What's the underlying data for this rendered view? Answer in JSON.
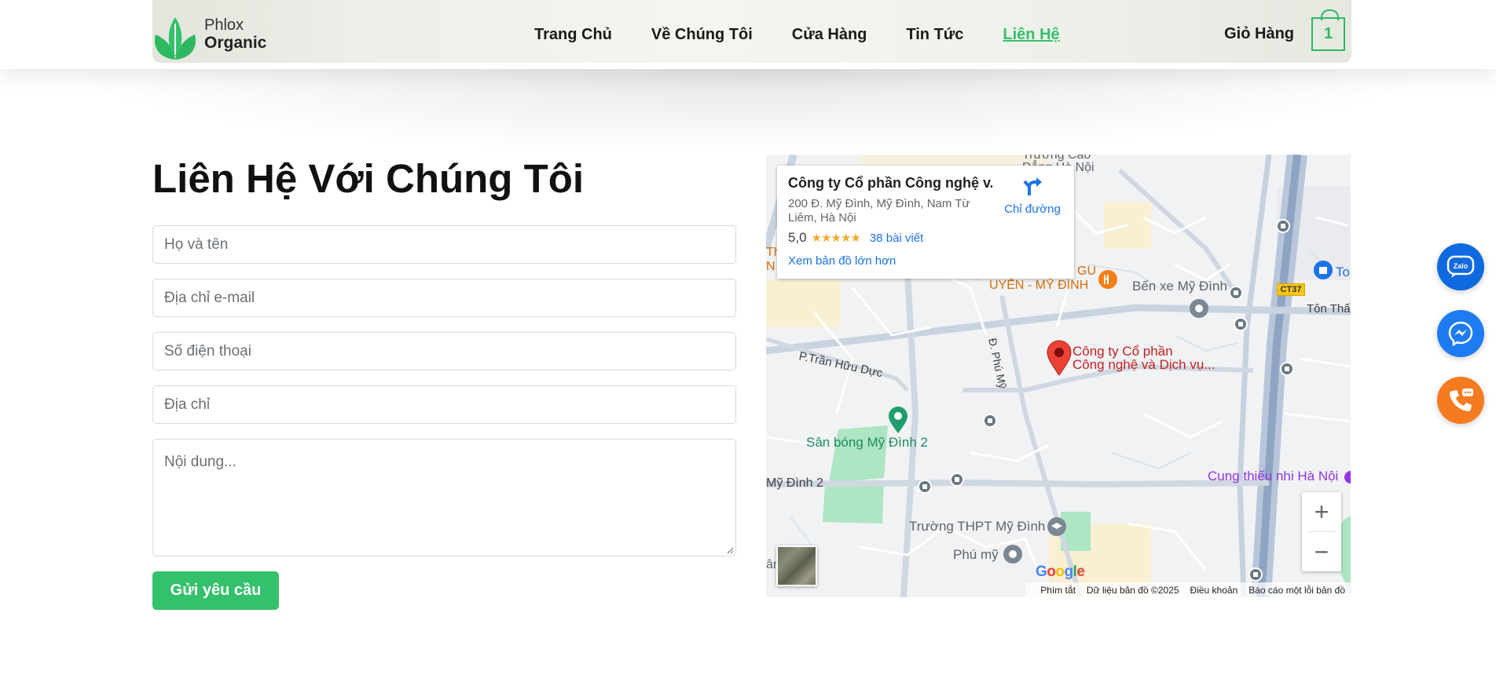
{
  "header": {
    "logo_top": "Phlox",
    "logo_bottom": "Organic",
    "nav": [
      "Trang Chủ",
      "Về Chúng Tôi",
      "Cửa Hàng",
      "Tin Tức",
      "Liên Hệ"
    ],
    "active_nav": "Liên Hệ",
    "cart_label": "Giỏ Hàng",
    "cart_count": "1"
  },
  "contact": {
    "title": "Liên Hệ Với Chúng Tôi",
    "name_placeholder": "Họ và tên",
    "email_placeholder": "Địa chỉ e-mail",
    "phone_placeholder": "Số điện thoại",
    "address_placeholder": "Địa chỉ",
    "message_placeholder": "Nội dung...",
    "submit_label": "Gửi yêu cầu"
  },
  "map": {
    "place_name": "Công ty Cổ phần Công nghệ v...",
    "address": "200 Đ. Mỹ Đình, Mỹ Đình, Nam Từ Liêm, Hà Nội",
    "rating": "5,0",
    "stars": "★★★★★",
    "reviews": "38 bài viết",
    "view_larger": "Xem bản đồ lớn hơn",
    "directions": "Chỉ đường",
    "labels": {
      "school_top": "Trường Cao",
      "hanoi_top": "Đẳng Hà Nội",
      "restaurant": "UYẾN - MỸ ĐÌNH",
      "gu": "GU",
      "bus_station": "Bến xe Mỹ Đình",
      "ct37": "CT37",
      "ton_that": "Tôn Thấ",
      "to": "To",
      "tran_huu_duc": "P.Trần Hữu Dực",
      "phu_my_road": "Đ. Phú Mỹ",
      "company_line1": "Công ty Cổ phần",
      "company_line2": "Công nghệ và Dịch vụ...",
      "stadium": "Sân bóng Mỹ Đình 2",
      "my_dinh_2": "Mỹ Đình 2",
      "thpt": "Trường THPT Mỹ Đình",
      "phu_my": "Phú mỹ",
      "cung_thieu_nhi": "Cung thiếu nhi Hà Nội",
      "left_t": "Th",
      "left_n": "N",
      "left_bottom": "ân",
      "left_bottom2": "nh"
    },
    "footer": [
      "Phím tắt",
      "Dữ liệu bản đồ ©2025",
      "Điều khoản",
      "Báo cáo một lỗi bản đồ"
    ],
    "google": "Google",
    "zoom_in": "+",
    "zoom_out": "−"
  },
  "floating": {
    "zalo": "Zalo"
  },
  "colors": {
    "brand_green": "#34c16b",
    "zalo_blue": "#0f6ae0",
    "messenger_blue": "#1e7bf2",
    "phone_orange": "#f57b20"
  }
}
